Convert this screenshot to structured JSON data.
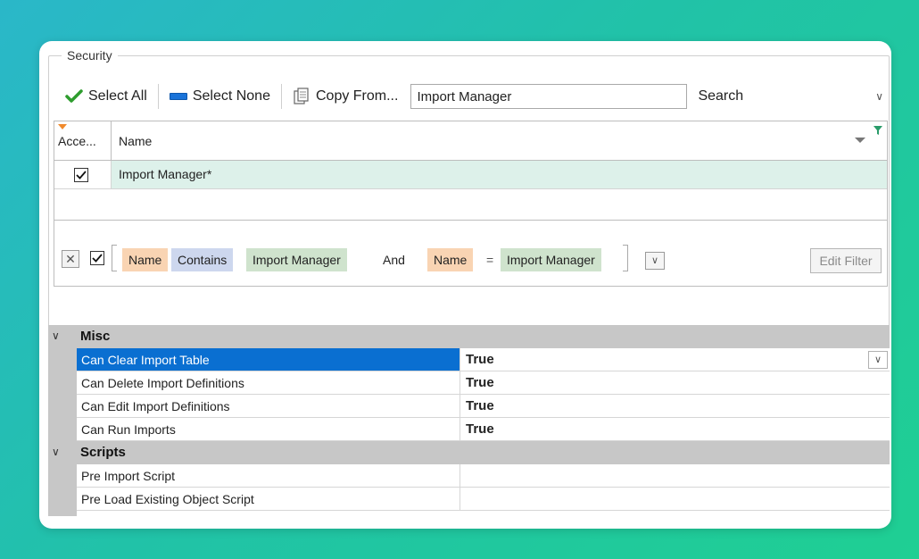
{
  "security": {
    "legend": "Security",
    "toolbar": {
      "select_all": "Select All",
      "select_none": "Select None",
      "copy_from": "Copy From...",
      "search_value": "Import Manager",
      "search_label": "Search"
    },
    "grid": {
      "columns": [
        "Acce...",
        "Name"
      ],
      "rows": [
        {
          "access": true,
          "name": "Import Manager*"
        }
      ]
    },
    "filter": {
      "enabled": true,
      "clauses": [
        {
          "field": "Name",
          "operator": "Contains",
          "value": "Import Manager"
        },
        {
          "joiner": "And"
        },
        {
          "field": "Name",
          "operator": "=",
          "value": "Import Manager"
        }
      ],
      "edit_filter_label": "Edit Filter"
    }
  },
  "properties": {
    "categories": [
      {
        "name": "Misc",
        "items": [
          {
            "name": "Can Clear Import Table",
            "value": "True",
            "selected": true
          },
          {
            "name": "Can Delete Import Definitions",
            "value": "True"
          },
          {
            "name": "Can Edit Import Definitions",
            "value": "True"
          },
          {
            "name": "Can Run Imports",
            "value": "True"
          }
        ]
      },
      {
        "name": "Scripts",
        "items": [
          {
            "name": "Pre Import Script",
            "value": ""
          },
          {
            "name": "Pre Load Existing Object Script",
            "value": ""
          }
        ]
      }
    ]
  },
  "colors": {
    "selected_row": "#0a6fd1",
    "grid_row_highlight": "#ddf1ea",
    "chip_field": "#f9d4b3",
    "chip_operator": "#cdd7ee",
    "chip_value": "#cfe3cd",
    "category_band": "#c7c7c7"
  },
  "icons": {
    "select_all": "check-icon",
    "select_none": "minus-icon",
    "copy_from": "copy-icon",
    "search_dropdown": "chevron-down-icon"
  }
}
